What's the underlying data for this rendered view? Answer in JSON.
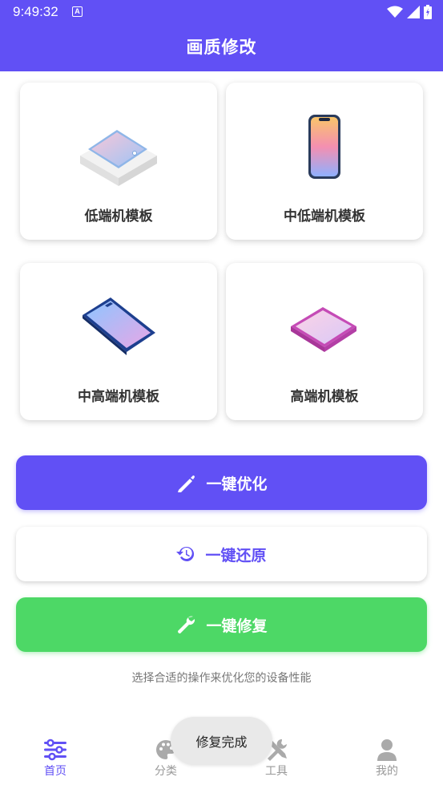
{
  "status_bar": {
    "time": "9:49:32",
    "notification_letter": "A"
  },
  "app_bar": {
    "title": "画质修改"
  },
  "templates": [
    {
      "label": "低端机模板",
      "icon": "tablet-flat-icon"
    },
    {
      "label": "中低端机模板",
      "icon": "phone-upright-icon"
    },
    {
      "label": "中高端机模板",
      "icon": "phone-tilted-icon"
    },
    {
      "label": "高端机模板",
      "icon": "phone-pink-icon"
    }
  ],
  "actions": {
    "optimize_label": "一键优化",
    "restore_label": "一键还原",
    "repair_label": "一键修复"
  },
  "hint": "选择合适的操作来优化您的设备性能",
  "bottom_nav": [
    {
      "label": "首页",
      "icon": "sliders-icon",
      "active": true
    },
    {
      "label": "分类",
      "icon": "palette-icon",
      "active": false
    },
    {
      "label": "工具",
      "icon": "tools-icon",
      "active": false
    },
    {
      "label": "我的",
      "icon": "person-icon",
      "active": false
    }
  ],
  "toast": "修复完成",
  "colors": {
    "primary": "#6150f5",
    "success": "#4dd866",
    "nav_inactive": "#999999"
  }
}
